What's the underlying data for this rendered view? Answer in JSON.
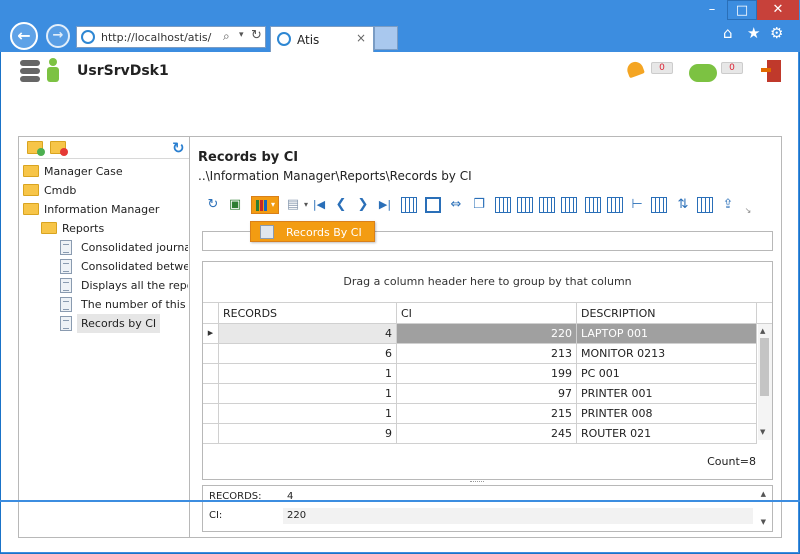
{
  "browser": {
    "url": "http://localhost/atis/",
    "tab_title": "Atis",
    "tab_close": "×",
    "window_controls": {
      "minimize": "–",
      "maximize": "□",
      "close": "✕"
    },
    "nav": {
      "back": "←",
      "forward": "→",
      "search": "⌕",
      "dropdown": "▾",
      "refresh": "↻"
    },
    "toolbar_icons": {
      "home": "⌂",
      "favorites": "★",
      "settings": "⚙"
    }
  },
  "header": {
    "app_title": "UsrSrvDsk1",
    "notifications_count": "0",
    "messages_count": "0"
  },
  "sidebar": {
    "refresh_glyph": "↻",
    "tree": [
      {
        "label": "Manager Case",
        "type": "folder"
      },
      {
        "label": "Cmdb",
        "type": "folder"
      },
      {
        "label": "Information Manager",
        "type": "folder"
      },
      {
        "label": "Reports",
        "type": "folder"
      },
      {
        "label": "Consolidated journal",
        "type": "doc"
      },
      {
        "label": "Consolidated betwee",
        "type": "doc"
      },
      {
        "label": "Displays all the repo",
        "type": "doc"
      },
      {
        "label": "The number of this s",
        "type": "doc"
      },
      {
        "label": "Records by CI",
        "type": "doc"
      }
    ]
  },
  "main": {
    "title": "Records by CI",
    "breadcrumb": "..\\Information Manager\\Reports\\Records by CI",
    "toolbar_glyphs": {
      "refresh": "↻",
      "save": "▣",
      "dropdown": "▾",
      "first": "|◀",
      "prev": "❮",
      "next": "❯",
      "last": "▶|",
      "move": "⇔",
      "copy": "❐",
      "sort": "⇅",
      "export": "⇪",
      "more": "↘"
    },
    "menu": {
      "item": "Records By CI"
    }
  },
  "grid": {
    "group_hint": "Drag a column header here to group by that column",
    "columns": [
      "RECORDS",
      "CI",
      "DESCRIPTION"
    ],
    "row_indicator": "▶",
    "rows": [
      {
        "records": "4",
        "ci": "220",
        "description": "LAPTOP 001"
      },
      {
        "records": "6",
        "ci": "213",
        "description": "MONITOR 0213"
      },
      {
        "records": "1",
        "ci": "199",
        "description": "PC 001"
      },
      {
        "records": "1",
        "ci": "97",
        "description": "PRINTER 001"
      },
      {
        "records": "1",
        "ci": "215",
        "description": "PRINTER 008"
      },
      {
        "records": "9",
        "ci": "245",
        "description": "ROUTER 021"
      }
    ],
    "count_label": "Count=8",
    "scroll_up": "▲",
    "scroll_down": "▼"
  },
  "detail": {
    "records_label": "RECORDS:",
    "records_value": "4",
    "ci_label": "CI:",
    "ci_value": "220",
    "scroll_up": "▲",
    "scroll_down": "▼"
  }
}
